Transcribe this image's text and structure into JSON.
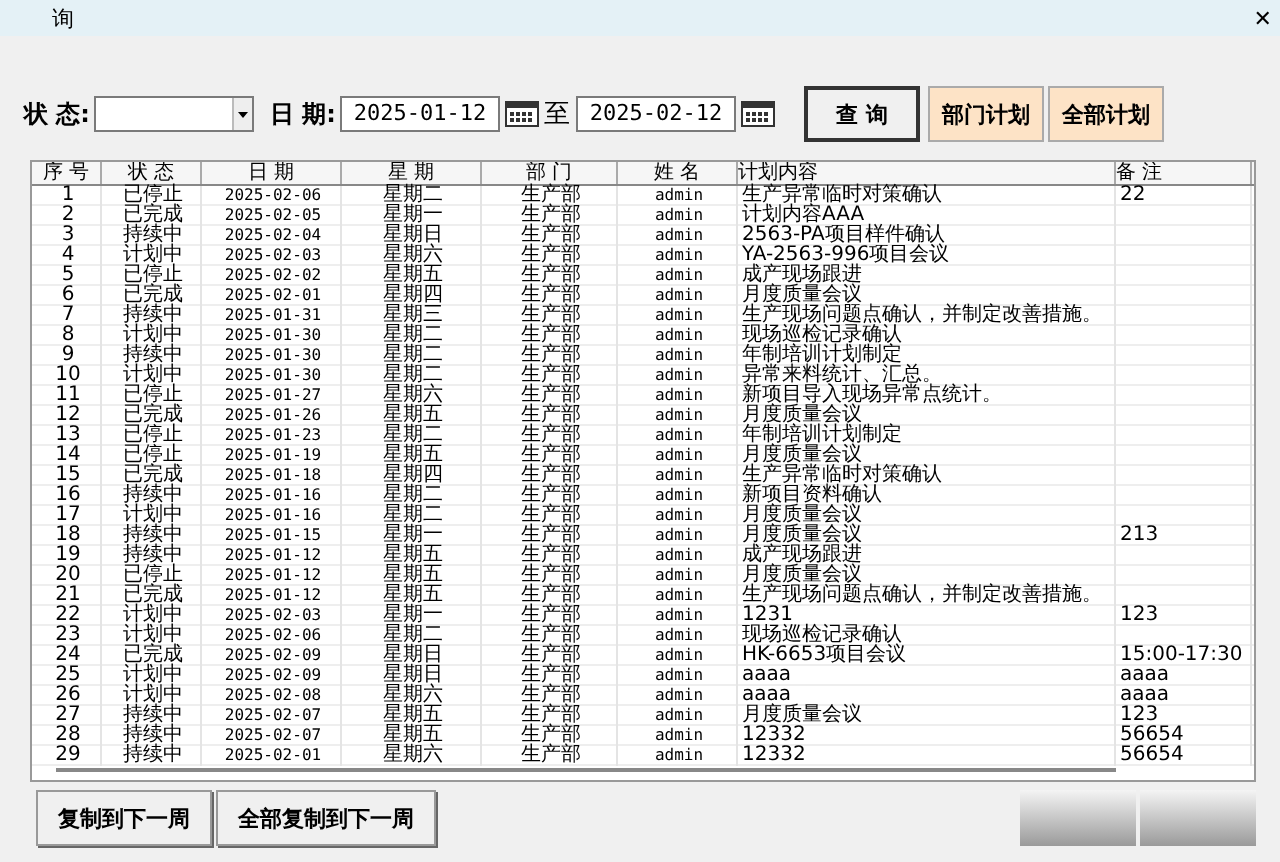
{
  "window": {
    "title": "询",
    "close": "✕"
  },
  "filter": {
    "status_label": "状 态:",
    "date_label": "日 期:",
    "date_from": "2025-01-12",
    "to_label": "至",
    "date_to": "2025-02-12"
  },
  "buttons": [
    {
      "label": "查 询",
      "kind": "default"
    },
    {
      "label": "部门计划",
      "kind": "accent"
    },
    {
      "label": "全部计划",
      "kind": "accent"
    }
  ],
  "table": {
    "columns": [
      "序 号",
      "状 态",
      "日 期",
      "星 期",
      "部 门",
      "姓 名",
      "计划内容",
      "备 注"
    ],
    "rows": [
      [
        "1",
        "已停止",
        "2025-02-06",
        "星期二",
        "生产部",
        "admin",
        "生产异常临时对策确认",
        "22"
      ],
      [
        "2",
        "已完成",
        "2025-02-05",
        "星期一",
        "生产部",
        "admin",
        "计划内容AAA",
        ""
      ],
      [
        "3",
        "持续中",
        "2025-02-04",
        "星期日",
        "生产部",
        "admin",
        "2563-PA项目样件确认",
        ""
      ],
      [
        "4",
        "计划中",
        "2025-02-03",
        "星期六",
        "生产部",
        "admin",
        "YA-2563-996项目会议",
        ""
      ],
      [
        "5",
        "已停止",
        "2025-02-02",
        "星期五",
        "生产部",
        "admin",
        "成产现场跟进",
        ""
      ],
      [
        "6",
        "已完成",
        "2025-02-01",
        "星期四",
        "生产部",
        "admin",
        "月度质量会议",
        ""
      ],
      [
        "7",
        "持续中",
        "2025-01-31",
        "星期三",
        "生产部",
        "admin",
        "生产现场问题点确认，并制定改善措施。",
        ""
      ],
      [
        "8",
        "计划中",
        "2025-01-30",
        "星期二",
        "生产部",
        "admin",
        "现场巡检记录确认",
        ""
      ],
      [
        "9",
        "持续中",
        "2025-01-30",
        "星期二",
        "生产部",
        "admin",
        "年制培训计划制定",
        ""
      ],
      [
        "10",
        "计划中",
        "2025-01-30",
        "星期二",
        "生产部",
        "admin",
        "异常来料统计、汇总。",
        ""
      ],
      [
        "11",
        "已停止",
        "2025-01-27",
        "星期六",
        "生产部",
        "admin",
        "新项目导入现场异常点统计。",
        ""
      ],
      [
        "12",
        "已完成",
        "2025-01-26",
        "星期五",
        "生产部",
        "admin",
        "月度质量会议",
        ""
      ],
      [
        "13",
        "已停止",
        "2025-01-23",
        "星期二",
        "生产部",
        "admin",
        "年制培训计划制定",
        ""
      ],
      [
        "14",
        "已停止",
        "2025-01-19",
        "星期五",
        "生产部",
        "admin",
        "月度质量会议",
        ""
      ],
      [
        "15",
        "已完成",
        "2025-01-18",
        "星期四",
        "生产部",
        "admin",
        "生产异常临时对策确认",
        ""
      ],
      [
        "16",
        "持续中",
        "2025-01-16",
        "星期二",
        "生产部",
        "admin",
        "新项目资料确认",
        ""
      ],
      [
        "17",
        "计划中",
        "2025-01-16",
        "星期二",
        "生产部",
        "admin",
        "月度质量会议",
        ""
      ],
      [
        "18",
        "持续中",
        "2025-01-15",
        "星期一",
        "生产部",
        "admin",
        "月度质量会议",
        "213"
      ],
      [
        "19",
        "持续中",
        "2025-01-12",
        "星期五",
        "生产部",
        "admin",
        "成产现场跟进",
        ""
      ],
      [
        "20",
        "已停止",
        "2025-01-12",
        "星期五",
        "生产部",
        "admin",
        "月度质量会议",
        ""
      ],
      [
        "21",
        "已完成",
        "2025-01-12",
        "星期五",
        "生产部",
        "admin",
        "生产现场问题点确认，并制定改善措施。",
        ""
      ],
      [
        "22",
        "计划中",
        "2025-02-03",
        "星期一",
        "生产部",
        "admin",
        "1231",
        "123"
      ],
      [
        "23",
        "计划中",
        "2025-02-06",
        "星期二",
        "生产部",
        "admin",
        "现场巡检记录确认",
        ""
      ],
      [
        "24",
        "已完成",
        "2025-02-09",
        "星期日",
        "生产部",
        "admin",
        "HK-6653项目会议",
        "15:00-17:30"
      ],
      [
        "25",
        "计划中",
        "2025-02-09",
        "星期日",
        "生产部",
        "admin",
        "aaaa",
        "aaaa"
      ],
      [
        "26",
        "计划中",
        "2025-02-08",
        "星期六",
        "生产部",
        "admin",
        "aaaa",
        "aaaa"
      ],
      [
        "27",
        "持续中",
        "2025-02-07",
        "星期五",
        "生产部",
        "admin",
        "月度质量会议",
        "123"
      ],
      [
        "28",
        "持续中",
        "2025-02-07",
        "星期五",
        "生产部",
        "admin",
        "12332",
        "56654"
      ],
      [
        "29",
        "持续中",
        "2025-02-01",
        "星期六",
        "生产部",
        "admin",
        "12332",
        "56654"
      ]
    ]
  },
  "footer_buttons": [
    {
      "label": "复制到下一周",
      "kind": "text"
    },
    {
      "label": "全部复制到下一周",
      "kind": "text"
    },
    {
      "kind": "blank"
    },
    {
      "kind": "blank"
    }
  ]
}
